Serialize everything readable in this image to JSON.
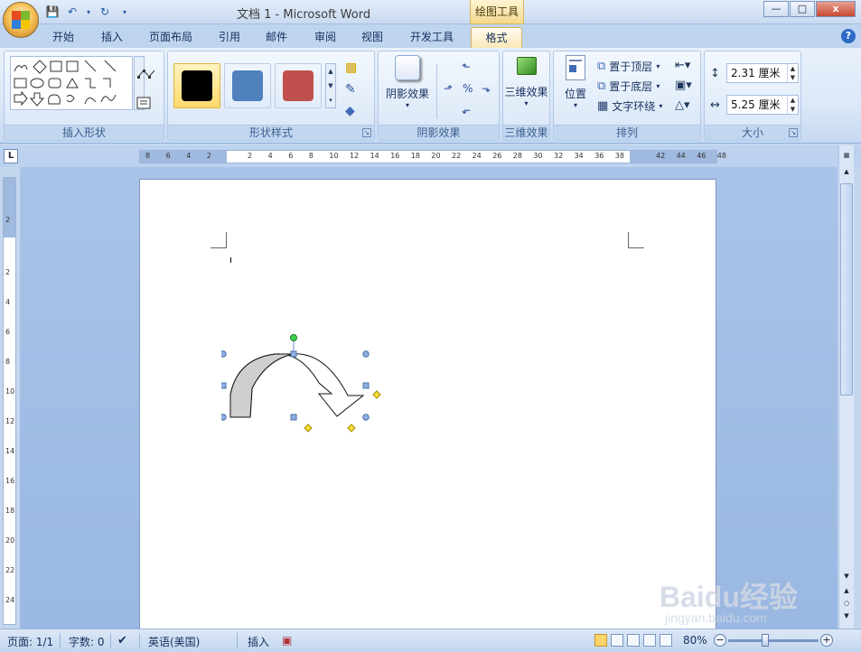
{
  "window": {
    "title": "文档 1 - Microsoft Word",
    "context_tab": "绘图工具"
  },
  "tabs": [
    "开始",
    "插入",
    "页面布局",
    "引用",
    "邮件",
    "审阅",
    "视图",
    "开发工具",
    "格式"
  ],
  "active_tab": "格式",
  "ribbon": {
    "groups": {
      "insert_shapes": "插入形状",
      "shape_styles": "形状样式",
      "shadow_effects": "阴影效果",
      "three_d": "三维效果",
      "arrange": "排列",
      "size": "大小"
    },
    "shadow_button": "阴影效果",
    "three_d_button": "三维效果",
    "position_button": "位置",
    "bring_to_front": "置于顶层",
    "send_to_back": "置于底层",
    "text_wrapping": "文字环绕",
    "height_value": "2.31 厘米",
    "width_value": "5.25 厘米",
    "style_swatches": [
      "#000000",
      "#4f81bd",
      "#c0504d"
    ]
  },
  "ruler": {
    "h_labels": [
      "8",
      "6",
      "4",
      "2",
      "2",
      "4",
      "6",
      "8",
      "10",
      "12",
      "14",
      "16",
      "18",
      "20",
      "22",
      "24",
      "26",
      "28",
      "30",
      "32",
      "34",
      "36",
      "38",
      "42",
      "44",
      "46",
      "48"
    ],
    "v_labels": [
      "2",
      "2",
      "4",
      "6",
      "8",
      "10",
      "12",
      "14",
      "16",
      "18",
      "20",
      "22",
      "24"
    ]
  },
  "status": {
    "page": "页面: 1/1",
    "words": "字数: 0",
    "language": "英语(美国)",
    "mode": "插入",
    "zoom": "80%"
  },
  "watermark": {
    "brand": "Baidu经验",
    "url": "jingyan.baidu.com"
  }
}
